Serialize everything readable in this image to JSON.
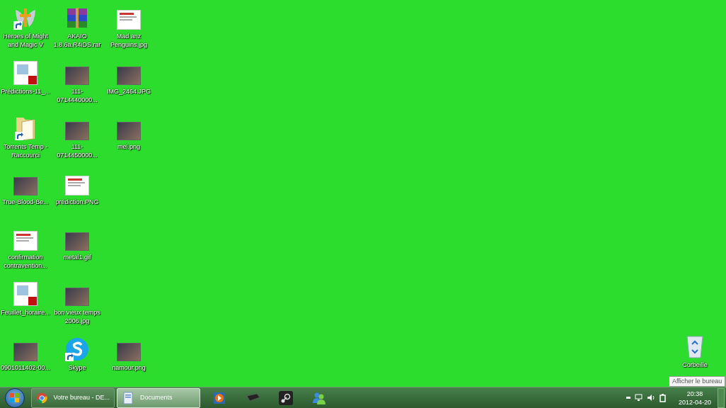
{
  "desktop_rows": [
    [
      {
        "label": "Heroes of Might and Magic V",
        "kind": "game",
        "shortcut": true
      },
      {
        "label": "AKAIO 1.8.6a.R4iDS.rar",
        "kind": "archive",
        "shortcut": false
      },
      {
        "label": "Mad anz Penguins.jpg",
        "kind": "document",
        "shortcut": false
      }
    ],
    [
      {
        "label": "Prédictions-11_...",
        "kind": "pdf",
        "shortcut": false
      },
      {
        "label": "111-0714440000...",
        "kind": "photo",
        "shortcut": false
      },
      {
        "label": "IMG_2464.JPG",
        "kind": "photo",
        "shortcut": false
      }
    ],
    [
      {
        "label": "Torrents Temp - Raccourci",
        "kind": "folder",
        "shortcut": true
      },
      {
        "label": "111-0714450000...",
        "kind": "photo",
        "shortcut": false
      },
      {
        "label": "mel.png",
        "kind": "photo",
        "shortcut": false
      }
    ],
    [
      {
        "label": "True-Blood-Be...",
        "kind": "photo",
        "shortcut": false
      },
      {
        "label": "prédiction.PNG",
        "kind": "document",
        "shortcut": false
      }
    ],
    [
      {
        "label": "confirmation contravention...",
        "kind": "document",
        "shortcut": false
      },
      {
        "label": "metal1.gif",
        "kind": "photo",
        "shortcut": false
      }
    ],
    [
      {
        "label": "Feuillet_horaire...",
        "kind": "pdf",
        "shortcut": false
      },
      {
        "label": "bon vieux temps 2006.jpg",
        "kind": "photo",
        "shortcut": false
      }
    ],
    [
      {
        "label": "0901011402-00...",
        "kind": "photo",
        "shortcut": false
      },
      {
        "label": "Skype",
        "kind": "skype",
        "shortcut": true
      },
      {
        "label": "namour.png",
        "kind": "photo",
        "shortcut": false
      }
    ]
  ],
  "recycle_bin": {
    "label": "Corbeille"
  },
  "taskbar": {
    "windows": [
      {
        "label": "Votre bureau - DE...",
        "kind": "browser",
        "selected": false
      },
      {
        "label": "Documents",
        "kind": "explorer",
        "selected": true
      }
    ],
    "pinned": [
      {
        "kind": "media"
      },
      {
        "kind": "console"
      },
      {
        "kind": "steam"
      },
      {
        "kind": "messenger"
      }
    ],
    "clock": {
      "time": "20:38",
      "date": "2012-04-20"
    },
    "tooltip": "Afficher le bureau"
  }
}
